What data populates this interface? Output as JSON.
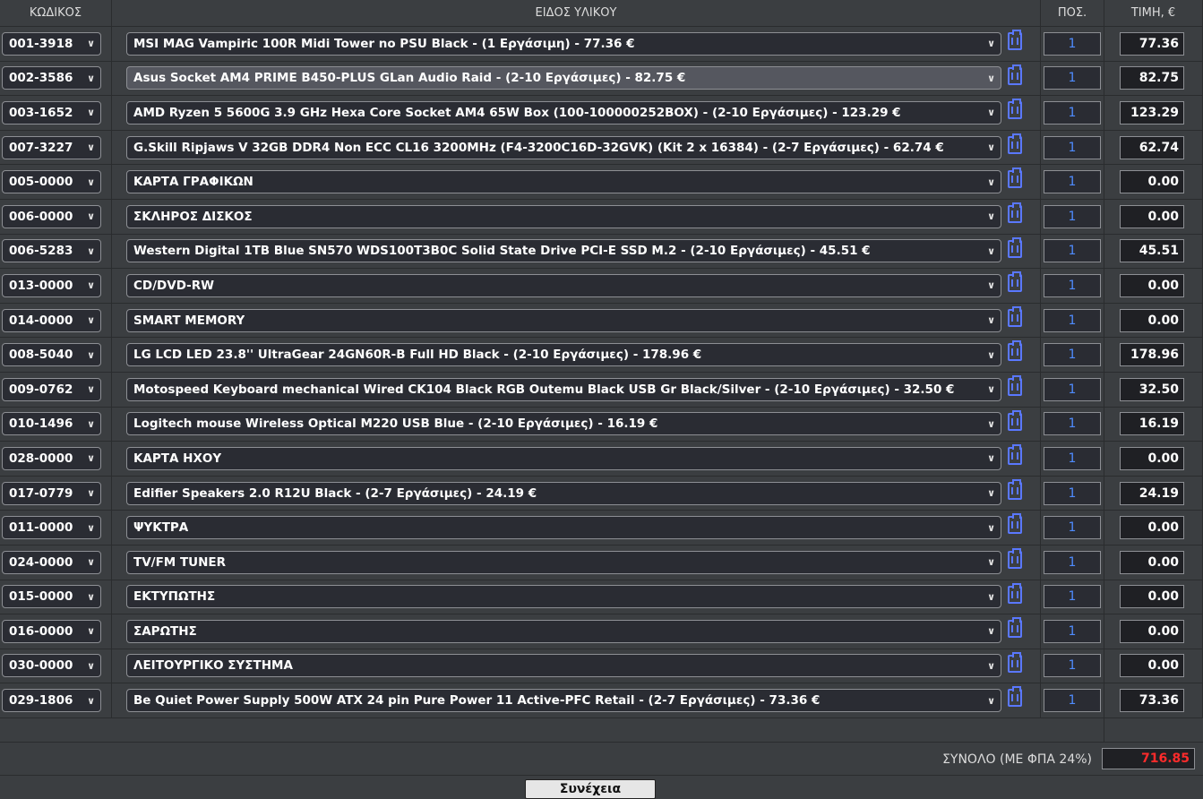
{
  "headers": {
    "code": "ΚΩΔΙΚΟΣ",
    "item": "ΕΙΔΟΣ ΥΛΙΚΟΥ",
    "qty": "ΠΟΣ.",
    "price": "ΤΙΜΗ, €"
  },
  "rows": [
    {
      "code": "001-3918",
      "item": "MSI MAG Vampiric 100R Midi Tower no PSU Black - (1 Εργάσιμη) - 77.36 €",
      "qty": "1",
      "price": "77.36",
      "active": false
    },
    {
      "code": "002-3586",
      "item": "Asus Socket AM4 PRIME B450-PLUS GLan Audio Raid - (2-10 Εργάσιμες) - 82.75 €",
      "qty": "1",
      "price": "82.75",
      "active": true
    },
    {
      "code": "003-1652",
      "item": "AMD Ryzen 5 5600G 3.9 GHz Hexa Core Socket AM4 65W Box (100-100000252BOX) - (2-10 Εργάσιμες) - 123.29 €",
      "qty": "1",
      "price": "123.29",
      "active": false
    },
    {
      "code": "007-3227",
      "item": "G.Skill Ripjaws V 32GB DDR4 Non ECC CL16 3200MHz (F4-3200C16D-32GVK) (Kit 2 x 16384) - (2-7 Εργάσιμες) - 62.74 €",
      "qty": "1",
      "price": "62.74",
      "active": false
    },
    {
      "code": "005-0000",
      "item": "ΚΑΡΤΑ ΓΡΑΦΙΚΩΝ",
      "qty": "1",
      "price": "0.00",
      "active": false
    },
    {
      "code": "006-0000",
      "item": "ΣΚΛΗΡΟΣ ΔΙΣΚΟΣ",
      "qty": "1",
      "price": "0.00",
      "active": false
    },
    {
      "code": "006-5283",
      "item": "Western Digital 1TB Blue SN570 WDS100T3B0C Solid State Drive PCI-E SSD M.2 - (2-10 Εργάσιμες) - 45.51 €",
      "qty": "1",
      "price": "45.51",
      "active": false
    },
    {
      "code": "013-0000",
      "item": "CD/DVD-RW",
      "qty": "1",
      "price": "0.00",
      "active": false
    },
    {
      "code": "014-0000",
      "item": "SMART MEMORY",
      "qty": "1",
      "price": "0.00",
      "active": false
    },
    {
      "code": "008-5040",
      "item": "LG LCD LED 23.8'' UltraGear 24GN60R-B Full HD Black - (2-10 Εργάσιμες) - 178.96 €",
      "qty": "1",
      "price": "178.96",
      "active": false
    },
    {
      "code": "009-0762",
      "item": "Motospeed Keyboard mechanical Wired CK104 Black RGB Outemu Black USB Gr Black/Silver - (2-10 Εργάσιμες) - 32.50 €",
      "qty": "1",
      "price": "32.50",
      "active": false
    },
    {
      "code": "010-1496",
      "item": "Logitech mouse Wireless Optical M220 USB Blue - (2-10 Εργάσιμες) - 16.19 €",
      "qty": "1",
      "price": "16.19",
      "active": false
    },
    {
      "code": "028-0000",
      "item": "ΚΑΡΤΑ ΗΧΟΥ",
      "qty": "1",
      "price": "0.00",
      "active": false
    },
    {
      "code": "017-0779",
      "item": "Edifier Speakers 2.0 R12U Black - (2-7 Εργάσιμες) - 24.19 €",
      "qty": "1",
      "price": "24.19",
      "active": false
    },
    {
      "code": "011-0000",
      "item": "ΨΥΚΤΡΑ",
      "qty": "1",
      "price": "0.00",
      "active": false
    },
    {
      "code": "024-0000",
      "item": "TV/FM TUNER",
      "qty": "1",
      "price": "0.00",
      "active": false
    },
    {
      "code": "015-0000",
      "item": "ΕΚΤΥΠΩΤΗΣ",
      "qty": "1",
      "price": "0.00",
      "active": false
    },
    {
      "code": "016-0000",
      "item": "ΣΑΡΩΤΗΣ",
      "qty": "1",
      "price": "0.00",
      "active": false
    },
    {
      "code": "030-0000",
      "item": "ΛΕΙΤΟΥΡΓΙΚΟ ΣΥΣΤΗΜΑ",
      "qty": "1",
      "price": "0.00",
      "active": false
    },
    {
      "code": "029-1806",
      "item": "Be Quiet Power Supply 500W ATX 24 pin Pure Power 11 Active-PFC Retail - (2-7 Εργάσιμες) - 73.36 €",
      "qty": "1",
      "price": "73.36",
      "active": false
    }
  ],
  "icons": {
    "dropdown": "chevron-down-icon",
    "clipboard": "clipboard-icon"
  },
  "total": {
    "label": "ΣΥΝΟΛΟ (ΜΕ ΦΠΑ 24%)",
    "value": "716.85"
  },
  "submit": {
    "label": "Συνέχεια"
  },
  "colors": {
    "background": "#3b3e41",
    "field": "#2a2c33",
    "qty_text": "#4f8cff",
    "total_text": "#ff2b2b",
    "icon": "#5a78ff"
  }
}
